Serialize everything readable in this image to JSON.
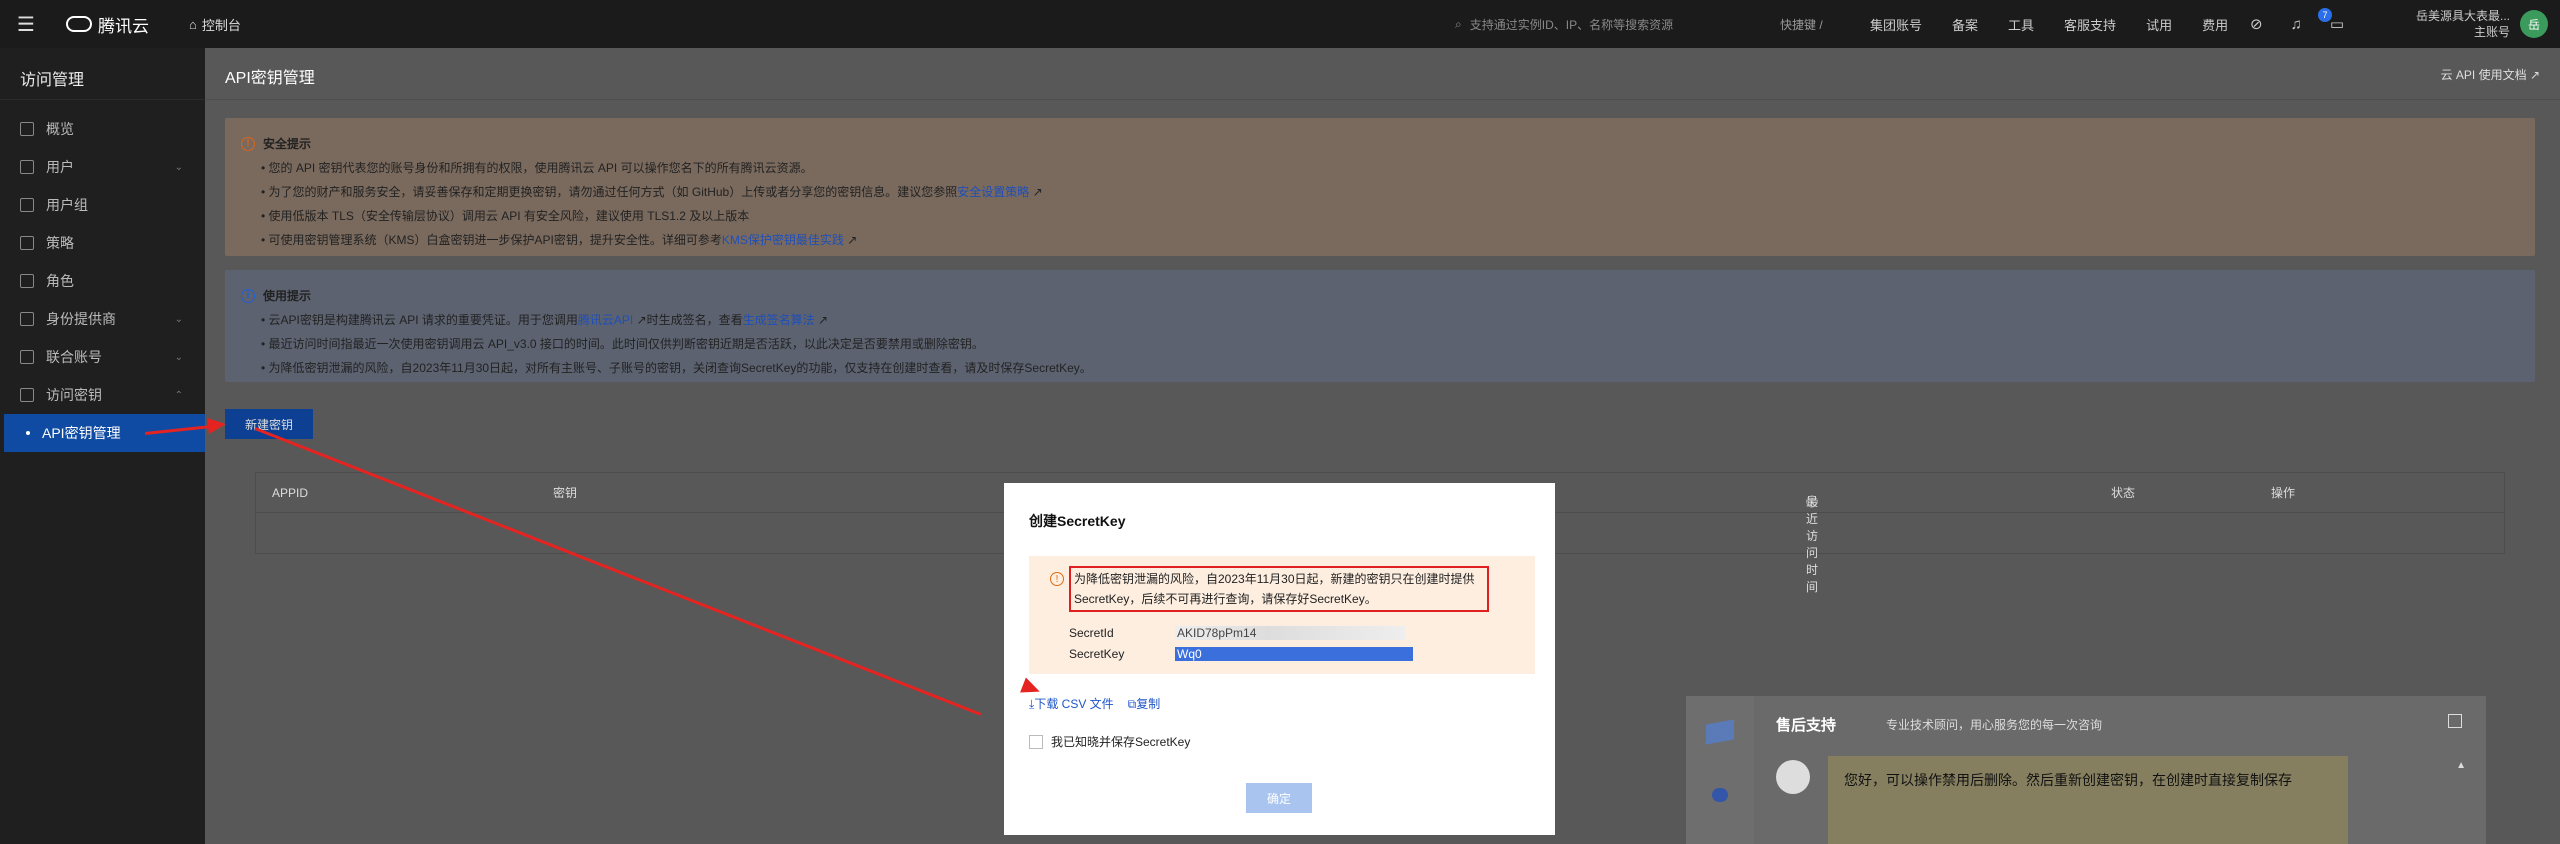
{
  "topbar": {
    "brand": "腾讯云",
    "console": "控制台",
    "search_placeholder": "支持通过实例ID、IP、名称等搜索资源",
    "shortcut": "快捷键 /",
    "links": [
      "集团账号",
      "备案",
      "工具",
      "客服支持",
      "试用",
      "费用"
    ],
    "notification_count": "7",
    "user_name": "岳美源具大表最...",
    "user_role": "主账号",
    "avatar_text": "岳"
  },
  "sidebar": {
    "title": "访问管理",
    "items": [
      {
        "label": "概览",
        "chevron": false
      },
      {
        "label": "用户",
        "chevron": true
      },
      {
        "label": "用户组",
        "chevron": false
      },
      {
        "label": "策略",
        "chevron": false
      },
      {
        "label": "角色",
        "chevron": false
      },
      {
        "label": "身份提供商",
        "chevron": true
      },
      {
        "label": "联合账号",
        "chevron": true
      },
      {
        "label": "访问密钥",
        "chevron": true
      }
    ],
    "active_sub": "API密钥管理"
  },
  "main": {
    "title": "API密钥管理",
    "doc_link": "云 API 使用文档",
    "security": {
      "title": "安全提示",
      "items": [
        "您的 API 密钥代表您的账号身份和所拥有的权限，使用腾讯云 API 可以操作您名下的所有腾讯云资源。",
        "为了您的财产和服务安全，请妥善保存和定期更换密钥，请勿通过任何方式（如 GitHub）上传或者分享您的密钥信息。建议您参照",
        "使用低版本 TLS（安全传输层协议）调用云 API 有安全风险，建议使用 TLS1.2 及以上版本",
        "可使用密钥管理系统（KMS）白盒密钥进一步保护API密钥，提升安全性。详细可参考"
      ],
      "link1": "安全设置策略",
      "link2": "KMS保护密钥最佳实践"
    },
    "usage": {
      "title": "使用提示",
      "item1_a": "云API密钥是构建腾讯云 API 请求的重要凭证。用于您调用",
      "item1_link1": "腾讯云API",
      "item1_b": "时生成签名，查看",
      "item1_link2": "生成签名算法",
      "item2": "最近访问时间指最近一次使用密钥调用云 API_v3.0 接口的时间。此时间仅供判断密钥近期是否活跃，以此决定是否要禁用或删除密钥。",
      "item3": "为降低密钥泄漏的风险，自2023年11月30日起，对所有主账号、子账号的密钥，关闭查询SecretKey的功能，仅支持在创建时查看，请及时保存SecretKey。"
    },
    "create_button": "新建密钥",
    "table_headers": [
      "APPID",
      "密钥",
      "最近访问时间",
      "状态",
      "操作"
    ]
  },
  "modal": {
    "title": "创建SecretKey",
    "alert": "为降低密钥泄漏的风险，自2023年11月30日起，新建的密钥只在创建时提供SecretKey，后续不可再进行查询，请保存好SecretKey。",
    "secret_id_label": "SecretId",
    "secret_id_value": "AKID78pPm14",
    "secret_key_label": "SecretKey",
    "secret_key_value": "Wq0",
    "download_csv": "下载 CSV 文件",
    "copy": "复制",
    "acknowledge": "我已知晓并保存SecretKey",
    "confirm": "确定"
  },
  "help": {
    "title": "售后支持",
    "subtitle": "专业技术顾问，用心服务您的每一次咨询",
    "message": "您好，可以操作禁用后删除。然后重新创建密钥，在创建时直接复制保存"
  }
}
